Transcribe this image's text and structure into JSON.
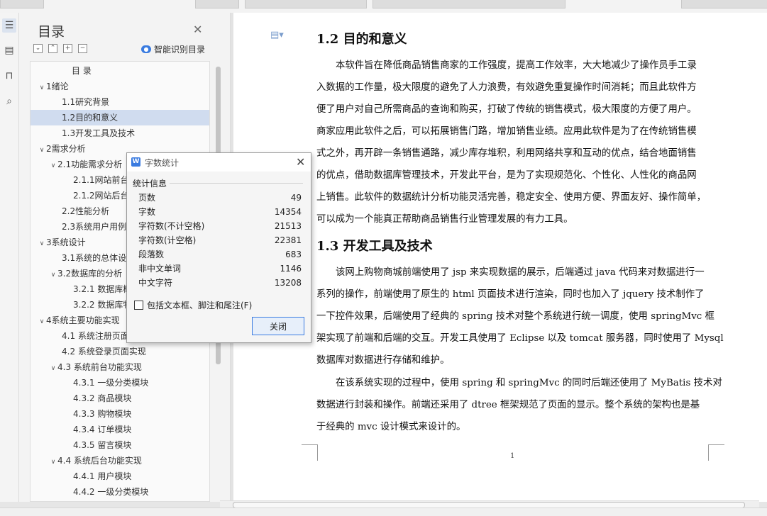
{
  "sidebar_icons": [
    "list-icon",
    "outline-icon",
    "bookmark-icon",
    "find-icon"
  ],
  "nav": {
    "title": "目录",
    "smart_label": "智能识别目录",
    "toc_heading": "目  录",
    "items": [
      {
        "label": "1绪论",
        "level": 1,
        "expanded": true
      },
      {
        "label": "1.1研究背景",
        "level": 2
      },
      {
        "label": "1.2目的和意义",
        "level": 2,
        "selected": true
      },
      {
        "label": "1.3开发工具及技术",
        "level": 2
      },
      {
        "label": "2需求分析",
        "level": 1,
        "expanded": true
      },
      {
        "label": "2.1功能需求分析",
        "level": 2,
        "expanded": true
      },
      {
        "label": "2.1.1网站前台",
        "level": 3
      },
      {
        "label": "2.1.2网站后台",
        "level": 3
      },
      {
        "label": "2.2性能分析",
        "level": 2
      },
      {
        "label": "2.3系统用户用例",
        "level": 2
      },
      {
        "label": "3系统设计",
        "level": 1,
        "expanded": true
      },
      {
        "label": "3.1系统的总体设",
        "level": 2
      },
      {
        "label": "3.2数据库的分析",
        "level": 2,
        "expanded": true
      },
      {
        "label": "3.2.1 数据库概",
        "level": 3
      },
      {
        "label": "3.2.2 数据库物",
        "level": 3
      },
      {
        "label": "4系统主要功能实现",
        "level": 1,
        "expanded": true
      },
      {
        "label": "4.1  系统注册页面",
        "level": 2
      },
      {
        "label": "4.2  系统登录页面实现",
        "level": 2
      },
      {
        "label": "4.3 系统前台功能实现",
        "level": 2,
        "expanded": true
      },
      {
        "label": "4.3.1 一级分类模块",
        "level": 3
      },
      {
        "label": "4.3.2 商品模块",
        "level": 3
      },
      {
        "label": "4.3.3 购物模块",
        "level": 3
      },
      {
        "label": "4.3.4 订单模块",
        "level": 3
      },
      {
        "label": "4.3.5 留言模块",
        "level": 3
      },
      {
        "label": "4.4 系统后台功能实现",
        "level": 2,
        "expanded": true
      },
      {
        "label": "4.4.1 用户模块",
        "level": 3
      },
      {
        "label": "4.4.2 一级分类模块",
        "level": 3
      }
    ]
  },
  "document": {
    "heading1": "1.2  目的和意义",
    "para1": [
      "本软件旨在降低商品销售商家的工作强度，提高工作效率，大大地减少了操作员手工录",
      "入数据的工作量，极大限度的避免了人力浪费，有效避免重复操作时间消耗；而且此软件方",
      "便了用户对自己所需商品的查询和购买，打破了传统的销售模式，极大限度的方便了用户。",
      "商家应用此软件之后，可以拓展销售门路，增加销售业绩。应用此软件是为了在传统销售模",
      "式之外，再开辟一条销售通路，减少库存堆积，利用网络共享和互动的优点，结合地面销售",
      "的优点，借助数据库管理技术，开发此平台，是为了实现规范化、个性化、人性化的商品网",
      "上销售。此软件的数据统计分析功能灵活完善，稳定安全、使用方便、界面友好、操作简单，",
      "可以成为一个能真正帮助商品销售行业管理发展的有力工具。"
    ],
    "heading2": "1.3  开发工具及技术",
    "para2": [
      "该网上购物商城前端使用了 jsp 来实现数据的展示，后端通过 java 代码来对数据进行一",
      "系列的操作，前端使用了原生的 html 页面技术进行渲染，同时也加入了 jquery 技术制作了",
      "一下控件效果，后端使用了经典的 spring 技术对整个系统进行统一调度，使用 springMvc 框",
      "架实现了前端和后端的交互。开发工具使用了 Eclipse 以及 tomcat 服务器，同时使用了 Mysql",
      "数据库对数据进行存储和维护。"
    ],
    "para3": [
      "在该系统实现的过程中，使用 spring 和 springMvc 的同时后端还使用了 MyBatis 技术对",
      "数据进行封装和操作。前端还采用了 dtree 框架规范了页面的显示。整个系统的架构也是基",
      "于经典的 mvc 设计模式来设计的。"
    ],
    "page_number": "1"
  },
  "dialog": {
    "title": "字数统计",
    "section": "统计信息",
    "stats": [
      {
        "label": "页数",
        "value": "49"
      },
      {
        "label": "字数",
        "value": "14354"
      },
      {
        "label": "字符数(不计空格)",
        "value": "21513"
      },
      {
        "label": "字符数(计空格)",
        "value": "22381"
      },
      {
        "label": "段落数",
        "value": "683"
      },
      {
        "label": "非中文单词",
        "value": "1146"
      },
      {
        "label": "中文字符",
        "value": "13208"
      }
    ],
    "checkbox_label": "包括文本框、脚注和尾注(F)",
    "close_label": "关闭"
  }
}
